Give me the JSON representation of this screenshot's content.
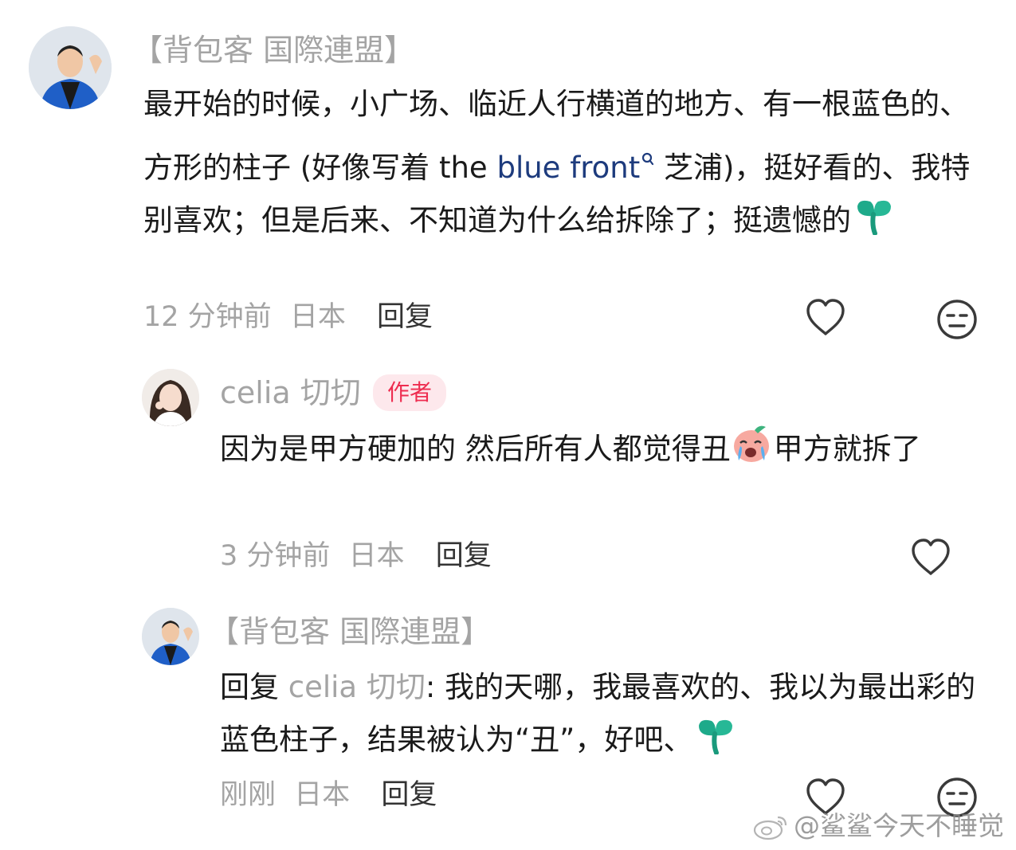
{
  "comments": [
    {
      "username": "【背包客 国際連盟】",
      "text_before_link": "最开始的时候，小广场、临近人行横道的地方、有一根蓝色的、方形的柱子 (好像写着 the ",
      "link_text": "blue front",
      "text_after_link": " 芝浦)，挺好看的、我特别喜欢；但是后来、不知道为什么给拆除了；挺遗憾的",
      "time": "12 分钟前",
      "location": "日本",
      "reply_label": "回复"
    }
  ],
  "replies": [
    {
      "username": "celia 切切",
      "badge": "作者",
      "text_part1": "因为是甲方硬加的 然后所有人都觉得丑",
      "text_part2": "甲方就拆了",
      "time": "3 分钟前",
      "location": "日本",
      "reply_label": "回复"
    },
    {
      "username": "【背包客 国際連盟】",
      "reply_prefix": "回复 ",
      "reply_to": "celia 切切",
      "text": ": 我的天哪，我最喜欢的、我以为最出彩的蓝色柱子，结果被认为“丑”，好吧、",
      "time": "刚刚",
      "location": "日本",
      "reply_label": "回复"
    }
  ],
  "icons": {
    "like": "heart-outline-icon",
    "dislike": "unamused-face-icon",
    "emoji_sprout": "sprout-emoji-icon",
    "emoji_crying": "crying-face-emoji-icon",
    "search_hint": "search-hint-icon"
  },
  "watermark": "@鲨鲨今天不睡觉",
  "colors": {
    "link": "#1d3b7d",
    "muted": "#a4a4a4",
    "badge_text": "#ee2d50",
    "badge_bg": "#fde8ec",
    "emoji_green": "#1eaa8a"
  }
}
